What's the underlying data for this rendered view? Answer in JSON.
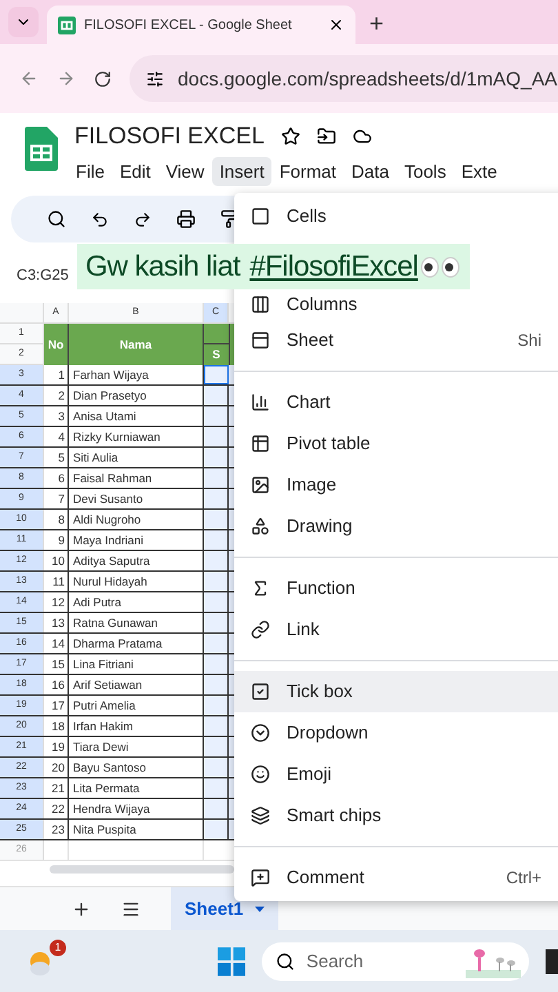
{
  "browser": {
    "tabs": [
      {
        "title": "FILOSOFI EXCEL - Google Sheet",
        "selected": true
      }
    ],
    "new_tab": "+",
    "url": "docs.google.com/spreadsheets/d/1mAQ_AA"
  },
  "doc": {
    "title": "FILOSOFI EXCEL",
    "menus": [
      {
        "label": "File",
        "selected": false
      },
      {
        "label": "Edit",
        "selected": false
      },
      {
        "label": "View",
        "selected": false
      },
      {
        "label": "Insert",
        "selected": true
      },
      {
        "label": "Format",
        "selected": false
      },
      {
        "label": "Data",
        "selected": false
      },
      {
        "label": "Tools",
        "selected": false
      },
      {
        "label": "Exte",
        "selected": false
      }
    ]
  },
  "name_box": "C3:G25",
  "caption": {
    "text": "Gw kasih liat",
    "hashtag": "#FilosofiExcel"
  },
  "sheet": {
    "columns": [
      "A",
      "B",
      "C"
    ],
    "header": {
      "no": "No",
      "name": "Nama",
      "column_3": "S"
    },
    "header_rows": [
      "1",
      "2"
    ],
    "rows": [
      {
        "row": "3",
        "no": "1",
        "name": "Farhan Wijaya"
      },
      {
        "row": "4",
        "no": "2",
        "name": "Dian Prasetyo"
      },
      {
        "row": "5",
        "no": "3",
        "name": "Anisa Utami"
      },
      {
        "row": "6",
        "no": "4",
        "name": "Rizky Kurniawan"
      },
      {
        "row": "7",
        "no": "5",
        "name": "Siti Aulia"
      },
      {
        "row": "8",
        "no": "6",
        "name": "Faisal Rahman"
      },
      {
        "row": "9",
        "no": "7",
        "name": "Devi Susanto"
      },
      {
        "row": "10",
        "no": "8",
        "name": "Aldi Nugroho"
      },
      {
        "row": "11",
        "no": "9",
        "name": "Maya Indriani"
      },
      {
        "row": "12",
        "no": "10",
        "name": "Aditya Saputra"
      },
      {
        "row": "13",
        "no": "11",
        "name": "Nurul Hidayah"
      },
      {
        "row": "14",
        "no": "12",
        "name": "Adi Putra"
      },
      {
        "row": "15",
        "no": "13",
        "name": "Ratna Gunawan"
      },
      {
        "row": "16",
        "no": "14",
        "name": "Dharma Pratama"
      },
      {
        "row": "17",
        "no": "15",
        "name": "Lina Fitriani"
      },
      {
        "row": "18",
        "no": "16",
        "name": "Arif Setiawan"
      },
      {
        "row": "19",
        "no": "17",
        "name": "Putri Amelia"
      },
      {
        "row": "20",
        "no": "18",
        "name": "Irfan Hakim"
      },
      {
        "row": "21",
        "no": "19",
        "name": "Tiara Dewi"
      },
      {
        "row": "22",
        "no": "20",
        "name": "Bayu Santoso"
      },
      {
        "row": "23",
        "no": "21",
        "name": "Lita Permata"
      },
      {
        "row": "24",
        "no": "22",
        "name": "Hendra Wijaya"
      },
      {
        "row": "25",
        "no": "23",
        "name": "Nita Puspita"
      }
    ],
    "empty_rows": [
      "26"
    ]
  },
  "insert_menu": [
    {
      "kind": "item",
      "label": "Cells",
      "highlighted": false
    },
    {
      "kind": "covered"
    },
    {
      "kind": "item",
      "label": "Columns",
      "highlighted": false
    },
    {
      "kind": "item",
      "label": "Sheet",
      "shortcut": "Shi",
      "highlighted": false
    },
    {
      "kind": "divider"
    },
    {
      "kind": "item",
      "label": "Chart",
      "highlighted": false
    },
    {
      "kind": "item",
      "label": "Pivot table",
      "highlighted": false
    },
    {
      "kind": "item",
      "label": "Image",
      "highlighted": false
    },
    {
      "kind": "item",
      "label": "Drawing",
      "highlighted": false
    },
    {
      "kind": "divider"
    },
    {
      "kind": "item",
      "label": "Function",
      "highlighted": false
    },
    {
      "kind": "item",
      "label": "Link",
      "highlighted": false
    },
    {
      "kind": "divider"
    },
    {
      "kind": "item",
      "label": "Tick box",
      "highlighted": true
    },
    {
      "kind": "item",
      "label": "Dropdown",
      "highlighted": false
    },
    {
      "kind": "item",
      "label": "Emoji",
      "highlighted": false
    },
    {
      "kind": "item",
      "label": "Smart chips",
      "highlighted": false
    },
    {
      "kind": "divider"
    },
    {
      "kind": "item",
      "label": "Comment",
      "shortcut": "Ctrl+",
      "highlighted": false
    }
  ],
  "sheet_tabs": [
    {
      "label": "Sheet1",
      "selected": true
    }
  ],
  "taskbar": {
    "weather_badge": "1",
    "search_placeholder": "Search"
  }
}
